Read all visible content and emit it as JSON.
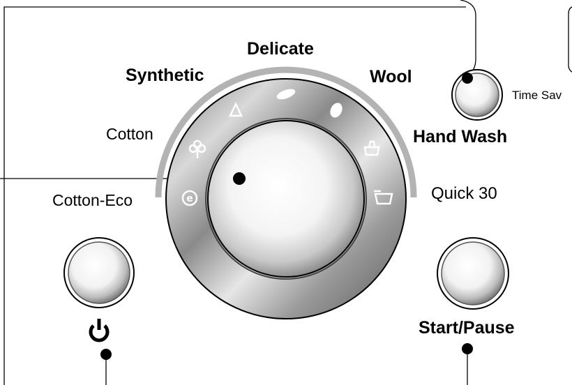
{
  "programmes": {
    "cotton_eco": "Cotton-Eco",
    "cotton": "Cotton",
    "synthetic": "Synthetic",
    "delicate": "Delicate",
    "wool": "Wool",
    "hand_wash": "Hand Wash",
    "quick_30": "Quick 30"
  },
  "buttons": {
    "time_saver": "Time Sav",
    "start_pause": "Start/Pause"
  },
  "icons": {
    "power": "power-icon",
    "eco": "eco-e-icon",
    "cotton": "cotton-flower-icon",
    "synthetic": "synthetic-triangle-icon",
    "delicate": "feather-icon",
    "wool": "wool-yarn-icon",
    "hand_wash": "hand-wash-basin-icon",
    "quick": "quick-wash-icon"
  },
  "colors": {
    "arc": "#b3b3b3",
    "line": "#000000",
    "background": "#ffffff"
  }
}
